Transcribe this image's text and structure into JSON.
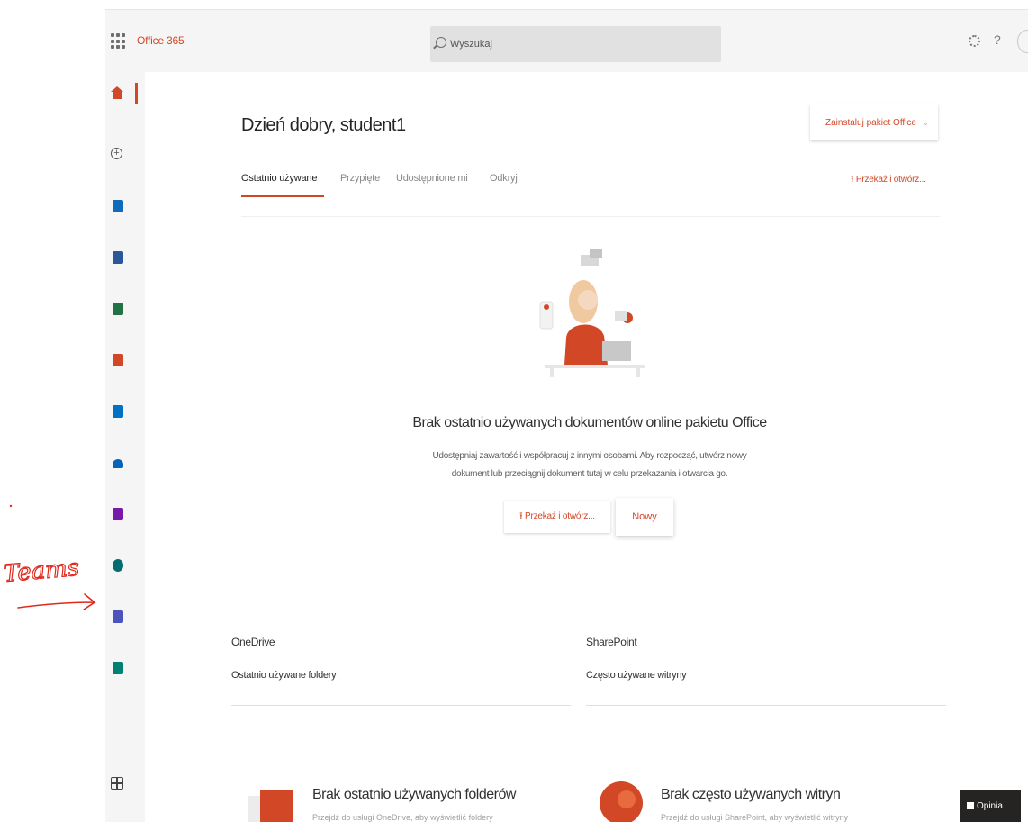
{
  "header": {
    "brand": "Office 365",
    "search_placeholder": "Wyszukaj",
    "help_label": "?"
  },
  "rail": {
    "apps": [
      {
        "name": "Outlook",
        "color": "#0f6cbd"
      },
      {
        "name": "Word",
        "color": "#2b579a"
      },
      {
        "name": "Excel",
        "color": "#217346"
      },
      {
        "name": "PowerPoint",
        "color": "#d24726"
      },
      {
        "name": "Outlook",
        "color": "#0072c6"
      },
      {
        "name": "OneDrive",
        "color": "#0364b8"
      },
      {
        "name": "OneNote",
        "color": "#7719aa"
      },
      {
        "name": "SharePoint",
        "color": "#036c70"
      },
      {
        "name": "Teams",
        "color": "#4b53bc"
      },
      {
        "name": "Sway",
        "color": "#008272"
      }
    ]
  },
  "annotation": {
    "text": "Teams",
    "color": "#e0281c"
  },
  "main": {
    "greeting": "Dzień dobry, student1",
    "install_button": "Zainstaluj pakiet Office",
    "tabs": [
      {
        "label": "Ostatnio używane",
        "active": true
      },
      {
        "label": "Przypięte",
        "active": false
      },
      {
        "label": "Udostępnione mi",
        "active": false
      },
      {
        "label": "Odkryj",
        "active": false
      }
    ],
    "upload_link": "Przekaż i otwórz...",
    "empty_state": {
      "title": "Brak ostatnio używanych dokumentów online pakietu Office",
      "description": "Udostępniaj zawartość i współpracuj z innymi osobami. Aby rozpocząć, utwórz nowy dokument lub przeciągnij dokument tutaj w celu przekazania i otwarcia go.",
      "upload_button": "Przekaż i otwórz...",
      "new_button": "Nowy"
    },
    "onedrive": {
      "title": "OneDrive",
      "subtitle": "Ostatnio używane foldery",
      "empty_title": "Brak ostatnio używanych folderów",
      "empty_desc": "Przejdź do usługi OneDrive, aby wyświetlić foldery"
    },
    "sharepoint": {
      "title": "SharePoint",
      "subtitle": "Często używane witryny",
      "empty_title": "Brak często używanych witryn",
      "empty_desc": "Przejdź do usługi SharePoint, aby wyświetlić witryny"
    }
  },
  "feedback": {
    "label": "Opinia"
  },
  "colors": {
    "accent": "#d24726",
    "rail_bg": "#f5f5f5"
  }
}
